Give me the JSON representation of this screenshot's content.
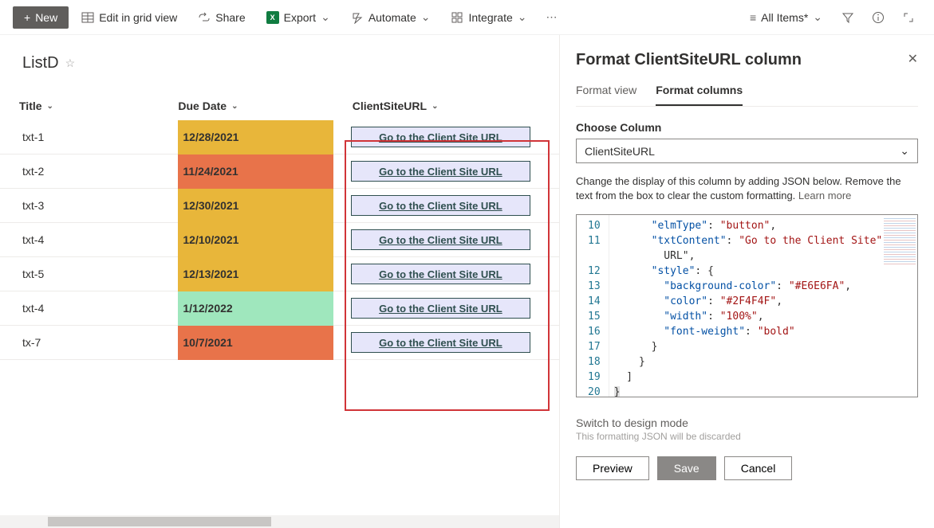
{
  "toolbar": {
    "new": "New",
    "edit_grid": "Edit in grid view",
    "share": "Share",
    "export": "Export",
    "automate": "Automate",
    "integrate": "Integrate",
    "all_items": "All Items*"
  },
  "list": {
    "title": "ListD",
    "columns": {
      "title": "Title",
      "due": "Due Date",
      "url": "ClientSiteURL"
    },
    "url_button_label": "Go to the Client Site URL",
    "rows": [
      {
        "title": "txt-1",
        "due": "12/28/2021",
        "due_class": "due-yellow"
      },
      {
        "title": "txt-2",
        "due": "11/24/2021",
        "due_class": "due-orange"
      },
      {
        "title": "txt-3",
        "due": "12/30/2021",
        "due_class": "due-yellow"
      },
      {
        "title": "txt-4",
        "due": "12/10/2021",
        "due_class": "due-yellow"
      },
      {
        "title": "txt-5",
        "due": "12/13/2021",
        "due_class": "due-yellow"
      },
      {
        "title": "txt-4",
        "due": "1/12/2022",
        "due_class": "due-green"
      },
      {
        "title": "tx-7",
        "due": "10/7/2021",
        "due_class": "due-orange"
      }
    ]
  },
  "panel": {
    "title": "Format ClientSiteURL column",
    "tab_view": "Format view",
    "tab_columns": "Format columns",
    "choose_label": "Choose Column",
    "choose_value": "ClientSiteURL",
    "help": "Change the display of this column by adding JSON below. Remove the text from the box to clear the custom formatting. ",
    "learn_more": "Learn more",
    "design_link": "Switch to design mode",
    "design_sub": "This formatting JSON will be discarded",
    "preview": "Preview",
    "save": "Save",
    "cancel": "Cancel",
    "code_lines": [
      "10",
      "11",
      "",
      "12",
      "13",
      "14",
      "15",
      "16",
      "17",
      "18",
      "19",
      "20"
    ],
    "json_values": {
      "elmType": "button",
      "txtContent": "Go to the Client Site URL",
      "style": {
        "background-color": "#E6E6FA",
        "color": "#2F4F4F",
        "width": "100%",
        "font-weight": "bold"
      }
    }
  }
}
